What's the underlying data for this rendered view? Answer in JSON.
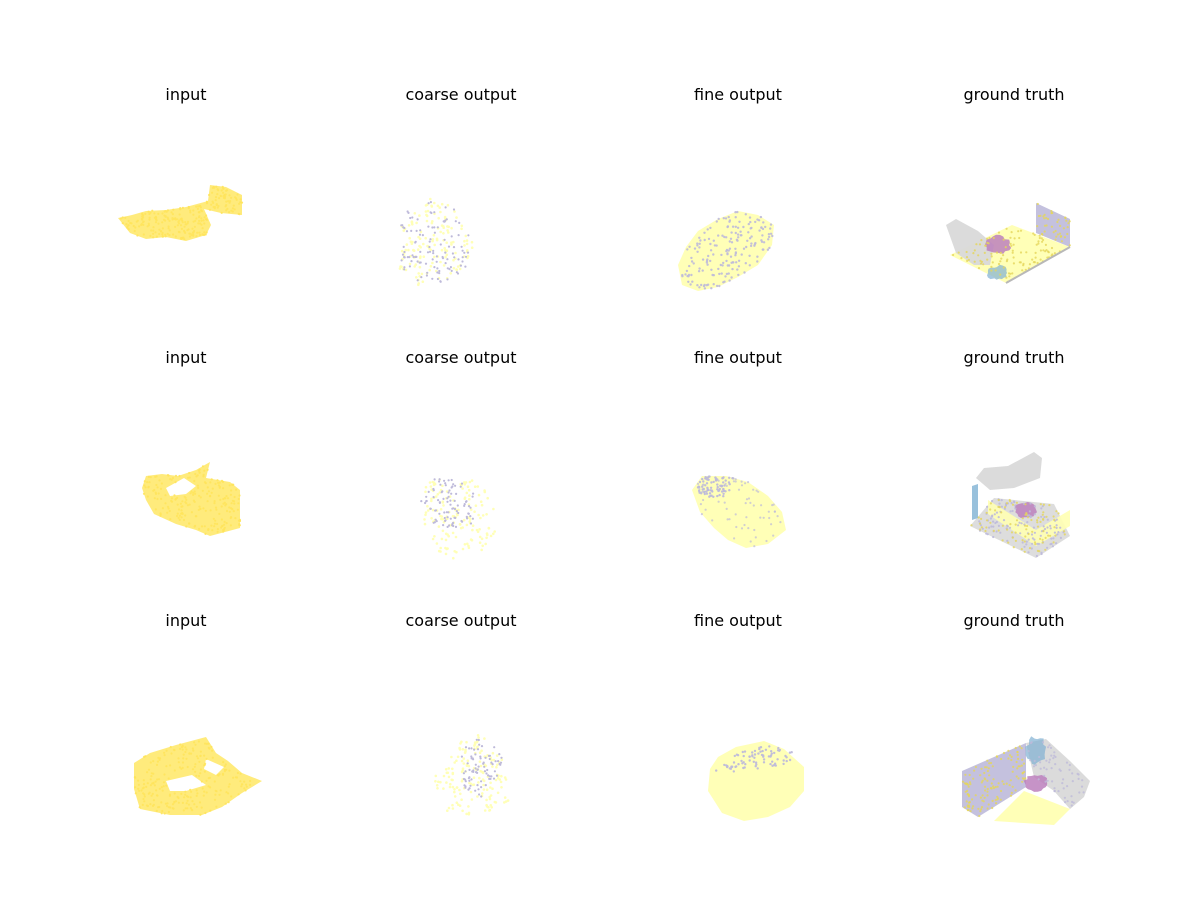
{
  "figure": {
    "rows": [
      {
        "panels": [
          {
            "title": "input",
            "kind": "input",
            "shape": "row1-input"
          },
          {
            "title": "coarse output",
            "kind": "coarse",
            "shape": "row1-coarse"
          },
          {
            "title": "fine output",
            "kind": "fine",
            "shape": "row1-fine"
          },
          {
            "title": "ground truth",
            "kind": "gt",
            "shape": "row1-gt"
          }
        ]
      },
      {
        "panels": [
          {
            "title": "input",
            "kind": "input",
            "shape": "row2-input"
          },
          {
            "title": "coarse output",
            "kind": "coarse",
            "shape": "row2-coarse"
          },
          {
            "title": "fine output",
            "kind": "fine",
            "shape": "row2-fine"
          },
          {
            "title": "ground truth",
            "kind": "gt",
            "shape": "row2-gt"
          }
        ]
      },
      {
        "panels": [
          {
            "title": "input",
            "kind": "input",
            "shape": "row3-input"
          },
          {
            "title": "coarse output",
            "kind": "coarse",
            "shape": "row3-coarse"
          },
          {
            "title": "fine output",
            "kind": "fine",
            "shape": "row3-fine"
          },
          {
            "title": "ground truth",
            "kind": "gt",
            "shape": "row3-gt"
          }
        ]
      }
    ]
  },
  "colors": {
    "input_yellow": "#ffea75",
    "light_yellow": "#ffffb3",
    "lavender": "#bebada",
    "gray": "#d9d9d9",
    "pink": "#bc80bd",
    "blue": "#80b1d3"
  }
}
